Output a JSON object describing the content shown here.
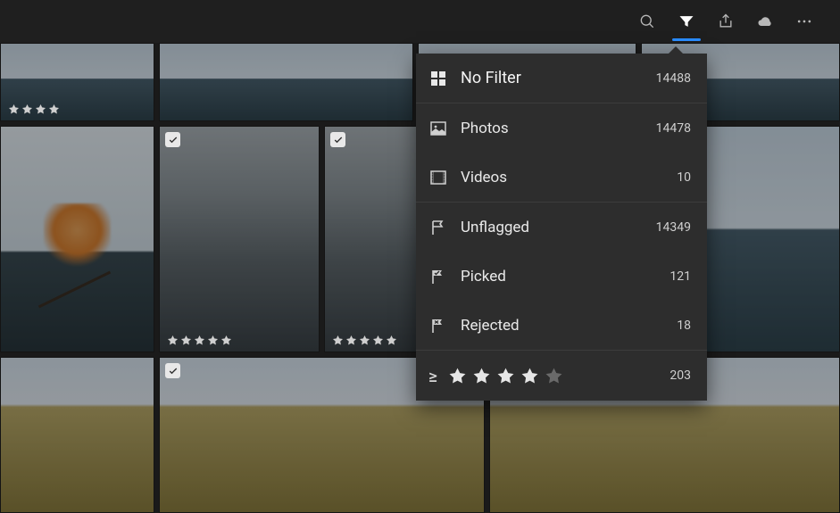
{
  "toolbar": {
    "icons": [
      "search-icon",
      "filter-icon",
      "share-icon",
      "cloud-icon",
      "more-icon"
    ],
    "active": "filter-icon"
  },
  "filter_panel": {
    "no_filter": {
      "label": "No Filter",
      "count": "14488"
    },
    "photos": {
      "label": "Photos",
      "count": "14478"
    },
    "videos": {
      "label": "Videos",
      "count": "10"
    },
    "unflagged": {
      "label": "Unflagged",
      "count": "14349"
    },
    "picked": {
      "label": "Picked",
      "count": "121"
    },
    "rejected": {
      "label": "Rejected",
      "count": "18"
    },
    "rating": {
      "operator": "≥",
      "stars_active": 4,
      "stars_total": 5,
      "count": "203"
    }
  },
  "thumbnails": [
    {
      "checked": false,
      "rating": 4,
      "scene": "sky"
    },
    {
      "checked": false,
      "rating": 0,
      "scene": "sky"
    },
    {
      "checked": false,
      "rating": 0,
      "scene": "sky"
    },
    {
      "checked": false,
      "rating": 0,
      "scene": "tree"
    },
    {
      "checked": true,
      "rating": 5,
      "scene": "rocks"
    },
    {
      "checked": true,
      "rating": 5,
      "scene": "rocks"
    },
    {
      "checked": false,
      "rating": 0,
      "scene": "sky"
    },
    {
      "checked": false,
      "rating": 0,
      "scene": "sky"
    },
    {
      "checked": true,
      "rating": 0,
      "scene": "field"
    },
    {
      "checked": false,
      "rating": 0,
      "scene": "field"
    },
    {
      "checked": false,
      "rating": 0,
      "scene": "field"
    }
  ]
}
